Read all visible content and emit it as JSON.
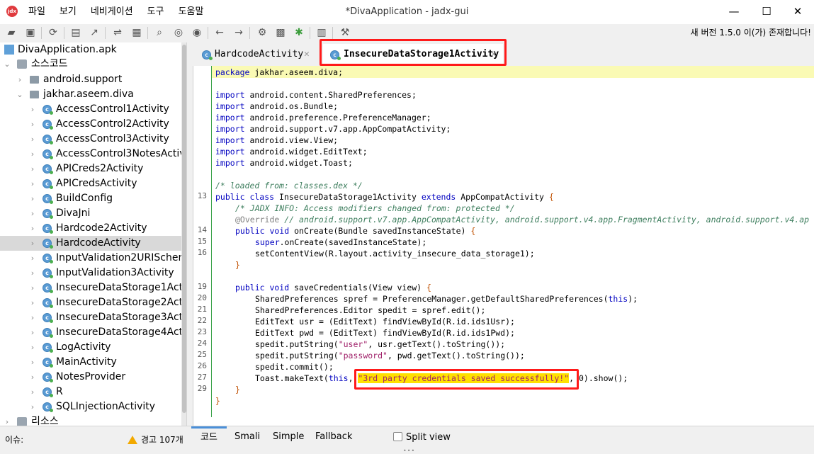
{
  "window": {
    "title": "*DivaApplication - jadx-gui",
    "app_icon": "jadx",
    "minimize": "—",
    "maximize": "☐",
    "close": "✕"
  },
  "menu": [
    "파일",
    "보기",
    "네비게이션",
    "도구",
    "도움말"
  ],
  "toolbar": {
    "icons": [
      "open-icon",
      "add-file-icon",
      "refresh-icon",
      "save-icon",
      "export-icon",
      "sync-icon",
      "tree-icon",
      "search-icon",
      "find-usage-icon",
      "goto-icon",
      "back-icon",
      "forward-icon",
      "decompile-icon",
      "deobf-icon",
      "debug-icon",
      "log-icon",
      "settings-icon"
    ],
    "update_note": "새 버전 1.5.0 이(가) 존재합니다!"
  },
  "tree": {
    "root": "DivaApplication.apk",
    "source": "소스코드",
    "packages": [
      "android.support",
      "jakhar.aseem.diva"
    ],
    "classes": [
      "AccessControl1Activity",
      "AccessControl2Activity",
      "AccessControl3Activity",
      "AccessControl3NotesActivity",
      "APICreds2Activity",
      "APICredsActivity",
      "BuildConfig",
      "DivaJni",
      "Hardcode2Activity",
      "HardcodeActivity",
      "InputValidation2URISchemeActivity",
      "InputValidation3Activity",
      "InsecureDataStorage1Activity",
      "InsecureDataStorage2Activity",
      "InsecureDataStorage3Activity",
      "InsecureDataStorage4Activity",
      "LogActivity",
      "MainActivity",
      "NotesProvider",
      "R",
      "SQLInjectionActivity"
    ],
    "selected": "HardcodeActivity",
    "resources": "리소스"
  },
  "tabs": [
    {
      "label": "HardcodeActivity",
      "active": false
    },
    {
      "label": "InsecureDataStorage1Activity",
      "active": true
    }
  ],
  "code": {
    "line_numbers": [
      "13",
      "14",
      "15",
      "16",
      "19",
      "20",
      "21",
      "22",
      "23",
      "24",
      "25",
      "26",
      "27",
      "29"
    ],
    "package_line": "jakhar.aseem.diva;",
    "imports": [
      "android.content.SharedPreferences;",
      "android.os.Bundle;",
      "android.preference.PreferenceManager;",
      "android.support.v7.app.AppCompatActivity;",
      "android.view.View;",
      "android.widget.EditText;",
      "android.widget.Toast;"
    ],
    "loaded_from": "/* loaded from: classes.dex */",
    "class_name": "InsecureDataStorage1Activity",
    "superclass": "AppCompatActivity",
    "jadx_info": "/* JADX INFO: Access modifiers changed from: protected */",
    "override": "@Override // android.support.v7.app.AppCompatActivity, android.support.v4.app.FragmentActivity, android.support.v4.ap",
    "toast_message": "\"3rd party credentials saved successfully!\""
  },
  "code_tabs": [
    "코드",
    "Smali",
    "Simple",
    "Fallback"
  ],
  "split_view": "Split view",
  "status": {
    "issues_label": "이슈:",
    "warnings": "경고 107개"
  },
  "colors": {
    "highlight_border": "#ff1a1a",
    "current_line": "#fafab4",
    "string_highlight": "#ffe000"
  }
}
